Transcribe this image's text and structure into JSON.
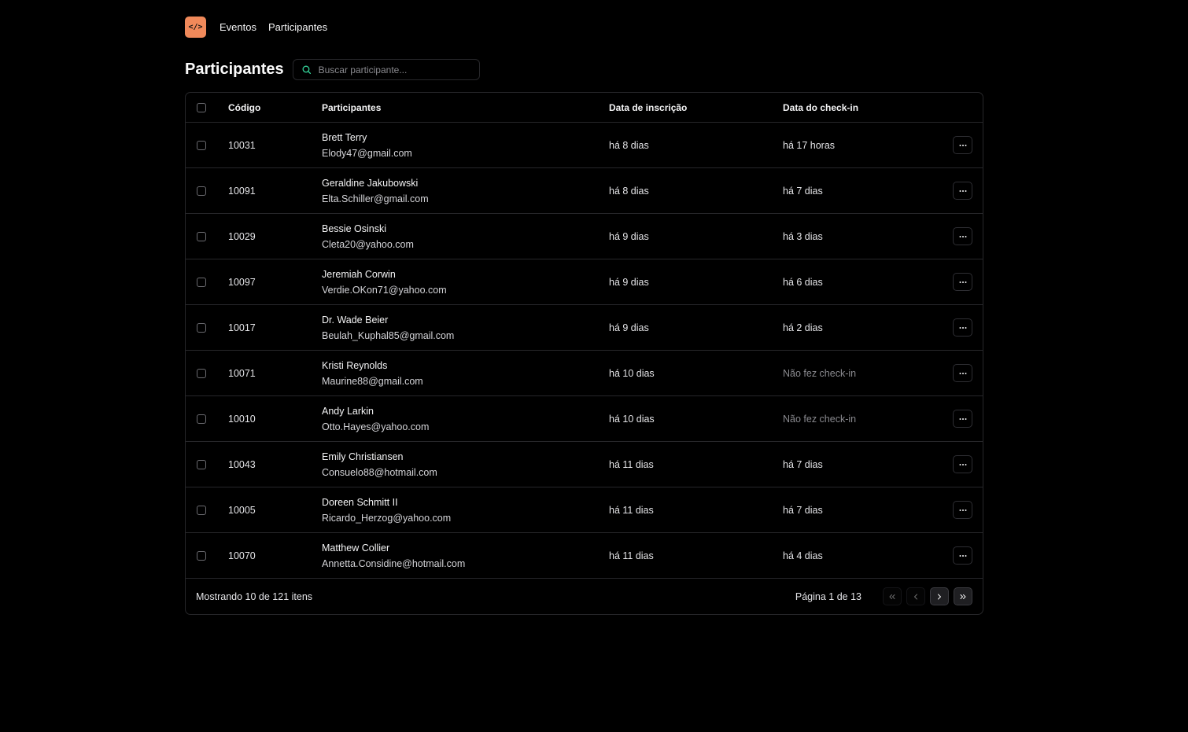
{
  "nav": {
    "logo_text": "</>",
    "links": [
      "Eventos",
      "Participantes"
    ]
  },
  "page": {
    "title": "Participantes"
  },
  "search": {
    "placeholder": "Buscar participante...",
    "value": "",
    "icon": "search-icon"
  },
  "table": {
    "headers": {
      "code": "Código",
      "participants": "Participantes",
      "subscribed": "Data de inscrição",
      "checkin": "Data do check-in"
    },
    "rows": [
      {
        "code": "10031",
        "name": "Brett Terry",
        "email": "Elody47@gmail.com",
        "subscribed": "há 8 dias",
        "checkin": "há 17 horas",
        "checked": true
      },
      {
        "code": "10091",
        "name": "Geraldine Jakubowski",
        "email": "Elta.Schiller@gmail.com",
        "subscribed": "há 8 dias",
        "checkin": "há 7 dias",
        "checked": true
      },
      {
        "code": "10029",
        "name": "Bessie Osinski",
        "email": "Cleta20@yahoo.com",
        "subscribed": "há 9 dias",
        "checkin": "há 3 dias",
        "checked": true
      },
      {
        "code": "10097",
        "name": "Jeremiah Corwin",
        "email": "Verdie.OKon71@yahoo.com",
        "subscribed": "há 9 dias",
        "checkin": "há 6 dias",
        "checked": true
      },
      {
        "code": "10017",
        "name": "Dr. Wade Beier",
        "email": "Beulah_Kuphal85@gmail.com",
        "subscribed": "há 9 dias",
        "checkin": "há 2 dias",
        "checked": true
      },
      {
        "code": "10071",
        "name": "Kristi Reynolds",
        "email": "Maurine88@gmail.com",
        "subscribed": "há 10 dias",
        "checkin": "Não fez check-in",
        "checked": false
      },
      {
        "code": "10010",
        "name": "Andy Larkin",
        "email": "Otto.Hayes@yahoo.com",
        "subscribed": "há 10 dias",
        "checkin": "Não fez check-in",
        "checked": false
      },
      {
        "code": "10043",
        "name": "Emily Christiansen",
        "email": "Consuelo88@hotmail.com",
        "subscribed": "há 11 dias",
        "checkin": "há 7 dias",
        "checked": true
      },
      {
        "code": "10005",
        "name": "Doreen Schmitt II",
        "email": "Ricardo_Herzog@yahoo.com",
        "subscribed": "há 11 dias",
        "checkin": "há 7 dias",
        "checked": true
      },
      {
        "code": "10070",
        "name": "Matthew Collier",
        "email": "Annetta.Considine@hotmail.com",
        "subscribed": "há 11 dias",
        "checkin": "há 4 dias",
        "checked": true
      }
    ]
  },
  "footer": {
    "showing": "Mostrando 10 de 121 itens",
    "page_info": "Página 1 de 13",
    "buttons": [
      "chevrons-left-icon",
      "chevron-left-icon",
      "chevron-right-icon",
      "chevrons-right-icon"
    ]
  },
  "colors": {
    "background": "#000000",
    "accent": "#f0895a",
    "search_icon": "#34d399",
    "border": "#27272a",
    "muted_text": "#8a8a8f"
  }
}
